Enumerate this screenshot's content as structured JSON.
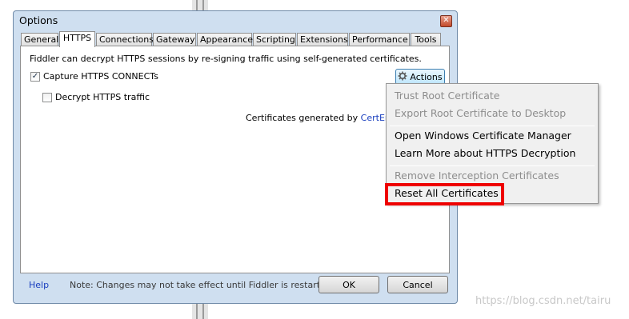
{
  "window": {
    "title": "Options",
    "close_glyph": "✕"
  },
  "tabs": [
    {
      "label": "General"
    },
    {
      "label": "HTTPS"
    },
    {
      "label": "Connections"
    },
    {
      "label": "Gateway"
    },
    {
      "label": "Appearance"
    },
    {
      "label": "Scripting"
    },
    {
      "label": "Extensions"
    },
    {
      "label": "Performance"
    },
    {
      "label": "Tools"
    }
  ],
  "https": {
    "description": "Fiddler can decrypt HTTPS sessions by re-signing traffic using self-generated certificates.",
    "capture_label": "Capture HTTPS CONNECTs",
    "capture_checked": "✓",
    "decrypt_label": "Decrypt HTTPS traffic",
    "certs_prefix": "Certificates generated by ",
    "certs_link": "CertEnroll e",
    "actions_label": "Actions"
  },
  "menu": {
    "items": [
      {
        "label": "Trust Root Certificate",
        "disabled": true
      },
      {
        "label": "Export Root Certificate to Desktop",
        "disabled": true
      },
      {
        "label": "Open Windows Certificate Manager",
        "disabled": false
      },
      {
        "label": "Learn More about HTTPS Decryption",
        "disabled": false
      },
      {
        "label": "Remove Interception Certificates",
        "disabled": true
      },
      {
        "label": "Reset All Certificates",
        "disabled": false
      }
    ]
  },
  "footer": {
    "help": "Help",
    "note": "Note: Changes may not take effect until Fiddler is restarted.",
    "ok": "OK",
    "cancel": "Cancel"
  },
  "watermark": "https://blog.csdn.net/tairu"
}
